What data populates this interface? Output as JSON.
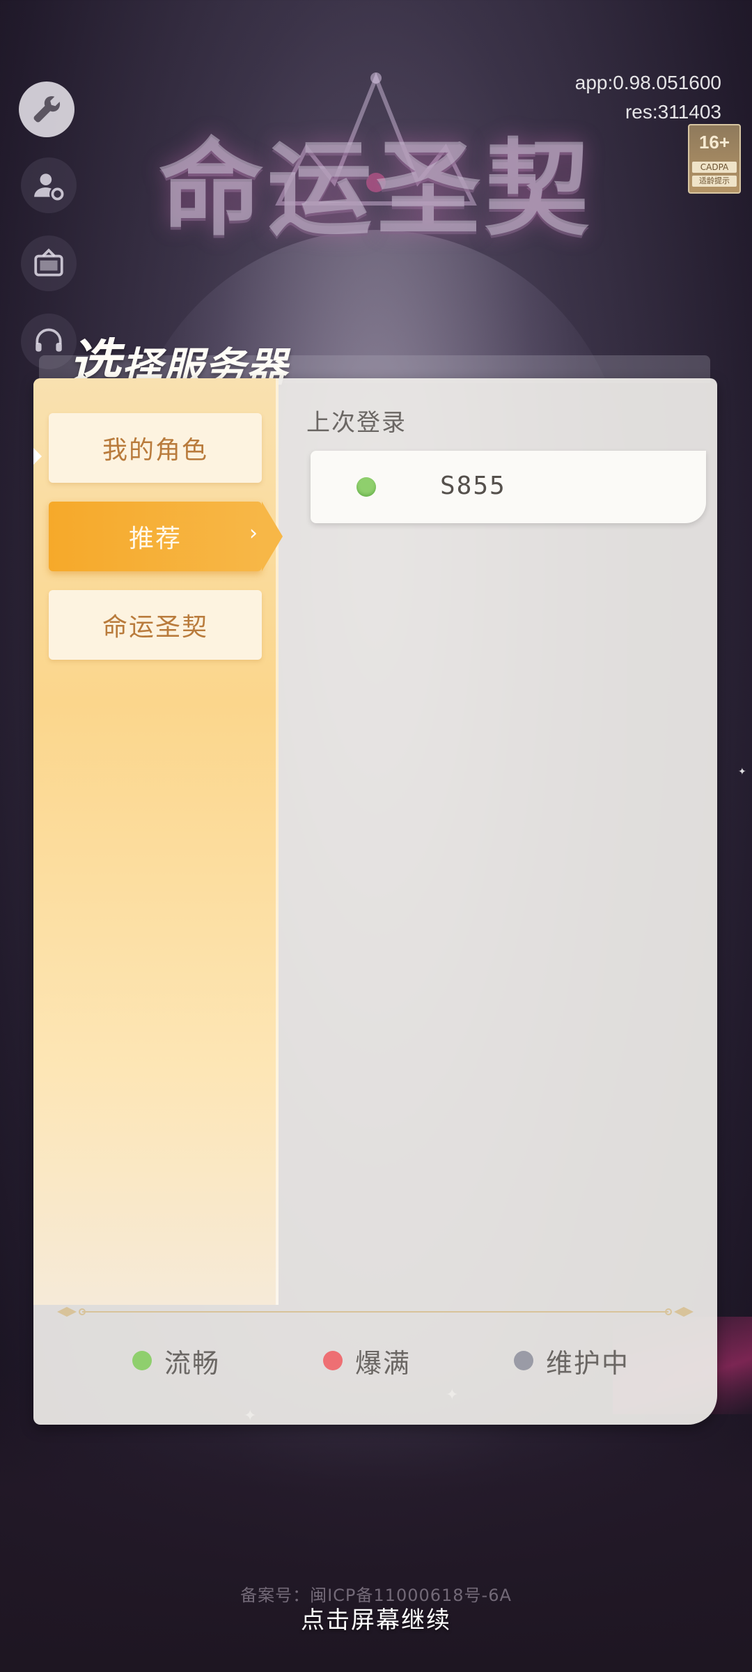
{
  "app_info": {
    "app_version": "app:0.98.051600",
    "res_version": "res:311403"
  },
  "age_badge": {
    "rating": "16+",
    "org": "CADPA",
    "label": "适龄提示"
  },
  "logo_text": "命运圣契",
  "side_buttons": [
    {
      "icon": "wrench-icon",
      "state": "active"
    },
    {
      "icon": "account-settings-icon",
      "state": "normal"
    },
    {
      "icon": "announcement-board-icon",
      "state": "normal"
    },
    {
      "icon": "customer-service-icon",
      "state": "normal"
    }
  ],
  "modal": {
    "title_first": "选",
    "title_rest": "择服务器",
    "tabs": [
      {
        "label": "我的角色",
        "selected": false
      },
      {
        "label": "推荐",
        "selected": true
      },
      {
        "label": "命运圣契",
        "selected": false
      }
    ],
    "section_label": "上次登录",
    "servers": [
      {
        "name": "S855",
        "status": "smooth"
      }
    ],
    "legend": [
      {
        "label": "流畅",
        "color": "#8fcf6d"
      },
      {
        "label": "爆满",
        "color": "#ee6f73"
      },
      {
        "label": "维护中",
        "color": "#9a9ba6"
      }
    ]
  },
  "footer": {
    "icp": "备案号：闽ICP备11000618号-6A",
    "tap_to_continue": "点击屏幕继续"
  }
}
